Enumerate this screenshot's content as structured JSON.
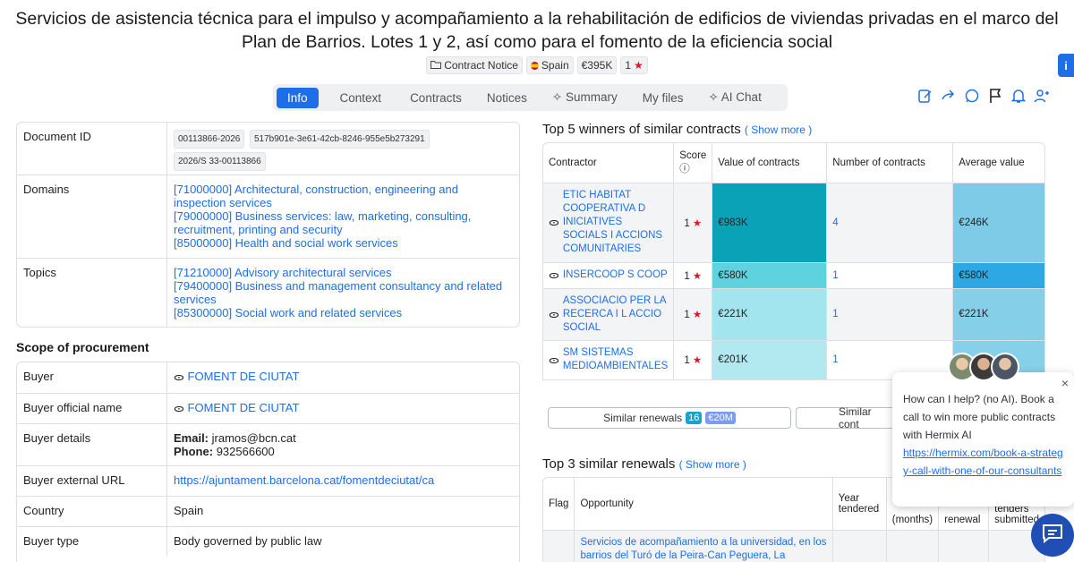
{
  "page": {
    "title": "Servicios de asistencia técnica para el impulso y acompañamiento a la rehabilitación de edificios de viviendas privadas en el marco del Plan de Barrios. Lotes 1 y 2, así como para el fomento de la eficiencia social",
    "tags": {
      "type": "Contract Notice",
      "country": "Spain",
      "value": "€395K",
      "rating": "1"
    },
    "info_icon": "i"
  },
  "tabs": [
    {
      "label": "Info",
      "active": true
    },
    {
      "label": "Context"
    },
    {
      "label": "Contracts"
    },
    {
      "label": "Notices"
    },
    {
      "label": "Summary",
      "icon": "sparkle-icon"
    },
    {
      "label": "My files"
    },
    {
      "label": "AI Chat",
      "icon": "sparkle-icon"
    }
  ],
  "details": {
    "document_id_label": "Document ID",
    "document_ids": [
      "00113866-2026",
      "517b901e-3e61-42cb-8246-955e5b273291",
      "2026/S 33-00113866"
    ],
    "domains_label": "Domains",
    "domains": [
      "[71000000] Architectural, construction, engineering and inspection services",
      "[79000000] Business services: law, marketing, consulting, recruitment, printing and security",
      "[85000000] Health and social work services"
    ],
    "topics_label": "Topics",
    "topics": [
      "[71210000] Advisory architectural services",
      "[79400000] Business and management consultancy and related services",
      "[85300000] Social work and related services"
    ]
  },
  "scope": {
    "heading": "Scope of procurement",
    "buyer_label": "Buyer",
    "buyer": "FOMENT DE CIUTAT",
    "official_name_label": "Buyer official name",
    "official_name": "FOMENT DE CIUTAT",
    "details_label": "Buyer details",
    "email_label": "Email:",
    "email": "jramos@bcn.cat",
    "phone_label": "Phone:",
    "phone": "932566600",
    "url_label": "Buyer external URL",
    "url": "https://ajuntament.barcelona.cat/fomentdeciutat/ca",
    "country_label": "Country",
    "country": "Spain",
    "buyer_type_label": "Buyer type",
    "buyer_type": "Body governed by public law"
  },
  "winners": {
    "heading": "Top 5 winners of similar contracts",
    "show_more": "( Show more )",
    "columns": [
      "Contractor",
      "Score",
      "Value of contracts",
      "Number of contracts",
      "Average value"
    ],
    "score_info": "ⓘ",
    "rows": [
      {
        "name": "ETIC HABITAT COOPERATIVA D INICIATIVES SOCIALS I ACCIONS COMUNITARIES",
        "score": "1",
        "value": "€983K",
        "count": "4",
        "avg": "€246K",
        "value_color": "#0aa2b6",
        "avg_color": "#7dcbe6"
      },
      {
        "name": "INSERCOOP S COOP",
        "score": "1",
        "value": "€580K",
        "count": "1",
        "avg": "€580K",
        "value_color": "#5fd2df",
        "avg_color": "#2ea8e4"
      },
      {
        "name": "ASSOCIACIO PER LA RECERCA I L ACCIO SOCIAL",
        "score": "1",
        "value": "€221K",
        "count": "1",
        "avg": "€221K",
        "value_color": "#a3e5ee",
        "avg_color": "#85cfe8"
      },
      {
        "name": "SM SISTEMAS MEDIOAMBIENTALES",
        "score": "1",
        "value": "€201K",
        "count": "1",
        "avg": "",
        "value_color": "#b2e9f1",
        "avg_color": "#87d0e9"
      }
    ]
  },
  "similar_buttons": {
    "renewals_label": "Similar renewals",
    "renewals_count": "16",
    "renewals_value": "€20M",
    "second_label": "Similar cont"
  },
  "renewals": {
    "heading": "Top 3 similar renewals",
    "show_more": "( Show more )",
    "columns": [
      "Flag",
      "Opportunity",
      "Year tendered",
      "(months)",
      "renewal",
      "tenders submitted"
    ],
    "rows": [
      {
        "opportunity": "Servicios de acompañamiento a la universidad, en los barrios del Turó de la Peira-Can Peguera, La"
      }
    ]
  },
  "chat": {
    "message": "How can I help? (no AI). Book a call to win more public contracts with Hermix AI",
    "link": "https://hermix.com/book-a-strategy-call-with-one-of-our-consultants",
    "close": "×"
  },
  "colors": {
    "accent": "#1e6ee8",
    "star": "#d81b2a",
    "chat_fab": "#1f4fb5"
  }
}
